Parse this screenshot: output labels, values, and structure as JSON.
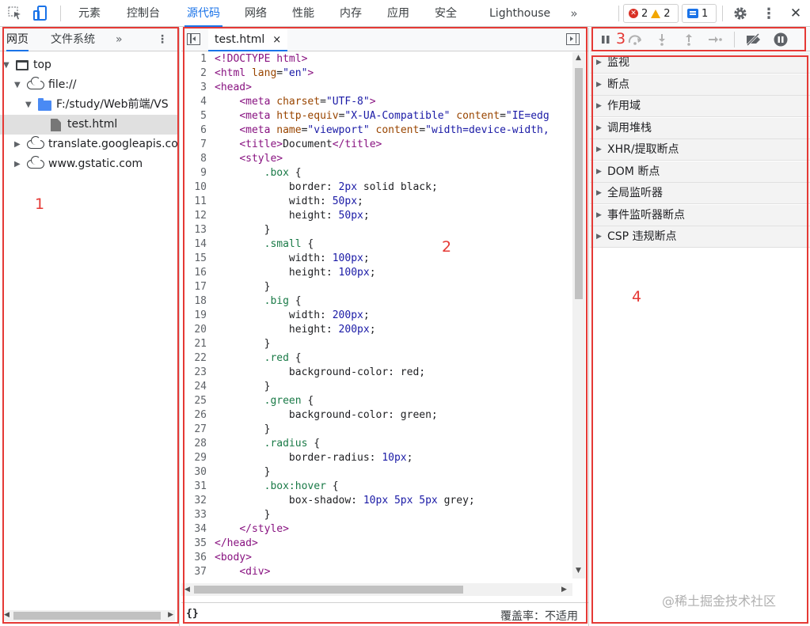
{
  "colors": {
    "accent": "#1a73e8",
    "annotation": "#e53935",
    "error": "#d93025",
    "warning": "#f2a600"
  },
  "toolbar": {
    "inspect_icon": "cursor-select-icon",
    "device_icon": "device-toggle-icon",
    "tabs": [
      "元素",
      "控制台",
      "源代码",
      "网络",
      "性能",
      "内存",
      "应用",
      "安全",
      "Lighthouse"
    ],
    "active_tab": "源代码",
    "more_tabs": "»",
    "errors": "2",
    "warnings": "2",
    "messages": "1",
    "settings_icon": "gear-icon",
    "menu_icon": "kebab-menu-icon",
    "close": "✕"
  },
  "navigator": {
    "tabs": [
      "网页",
      "文件系统"
    ],
    "more": "»",
    "menu": "⋮",
    "tree": [
      {
        "label": "top",
        "level": 0,
        "icon": "frame",
        "expanded": true
      },
      {
        "label": "file://",
        "level": 1,
        "icon": "cloud",
        "expanded": true
      },
      {
        "label": "F:/study/Web前端/VS",
        "level": 2,
        "icon": "folder",
        "expanded": true
      },
      {
        "label": "test.html",
        "level": 3,
        "icon": "file",
        "selected": true
      },
      {
        "label": "translate.googleapis.com",
        "level": 1,
        "icon": "cloud",
        "expanded": false
      },
      {
        "label": "www.gstatic.com",
        "level": 1,
        "icon": "cloud",
        "expanded": false
      }
    ]
  },
  "editor": {
    "file_tab": "test.html",
    "close_tab": "×",
    "pretty_print": "{}",
    "coverage": "覆盖率：不适用",
    "code": [
      [
        [
          "tag",
          "<!DOCTYPE html>"
        ]
      ],
      [
        [
          "tag",
          "<html "
        ],
        [
          "attr",
          "lang"
        ],
        [
          "text",
          "="
        ],
        [
          "str",
          "\"en\""
        ],
        [
          "tag",
          ">"
        ]
      ],
      [
        [
          "tag",
          "<head>"
        ]
      ],
      [
        [
          "text",
          "    "
        ],
        [
          "tag",
          "<meta "
        ],
        [
          "attr",
          "charset"
        ],
        [
          "text",
          "="
        ],
        [
          "str",
          "\"UTF-8\""
        ],
        [
          "tag",
          ">"
        ]
      ],
      [
        [
          "text",
          "    "
        ],
        [
          "tag",
          "<meta "
        ],
        [
          "attr",
          "http-equiv"
        ],
        [
          "text",
          "="
        ],
        [
          "str",
          "\"X-UA-Compatible\""
        ],
        [
          "text",
          " "
        ],
        [
          "attr",
          "content"
        ],
        [
          "text",
          "="
        ],
        [
          "str",
          "\"IE=edg"
        ]
      ],
      [
        [
          "text",
          "    "
        ],
        [
          "tag",
          "<meta "
        ],
        [
          "attr",
          "name"
        ],
        [
          "text",
          "="
        ],
        [
          "str",
          "\"viewport\""
        ],
        [
          "text",
          " "
        ],
        [
          "attr",
          "content"
        ],
        [
          "text",
          "="
        ],
        [
          "str",
          "\"width=device-width,"
        ]
      ],
      [
        [
          "text",
          "    "
        ],
        [
          "tag",
          "<title>"
        ],
        [
          "text",
          "Document"
        ],
        [
          "tag",
          "</title>"
        ]
      ],
      [
        [
          "text",
          "    "
        ],
        [
          "tag",
          "<style>"
        ]
      ],
      [
        [
          "text",
          "        "
        ],
        [
          "sel",
          ".box"
        ],
        [
          "text",
          " {"
        ]
      ],
      [
        [
          "text",
          "            border: "
        ],
        [
          "num",
          "2px"
        ],
        [
          "text",
          " solid black;"
        ]
      ],
      [
        [
          "text",
          "            width: "
        ],
        [
          "num",
          "50px"
        ],
        [
          "text",
          ";"
        ]
      ],
      [
        [
          "text",
          "            height: "
        ],
        [
          "num",
          "50px"
        ],
        [
          "text",
          ";"
        ]
      ],
      [
        [
          "text",
          "        }"
        ]
      ],
      [
        [
          "text",
          "        "
        ],
        [
          "sel",
          ".small"
        ],
        [
          "text",
          " {"
        ]
      ],
      [
        [
          "text",
          "            width: "
        ],
        [
          "num",
          "100px"
        ],
        [
          "text",
          ";"
        ]
      ],
      [
        [
          "text",
          "            height: "
        ],
        [
          "num",
          "100px"
        ],
        [
          "text",
          ";"
        ]
      ],
      [
        [
          "text",
          "        }"
        ]
      ],
      [
        [
          "text",
          "        "
        ],
        [
          "sel",
          ".big"
        ],
        [
          "text",
          " {"
        ]
      ],
      [
        [
          "text",
          "            width: "
        ],
        [
          "num",
          "200px"
        ],
        [
          "text",
          ";"
        ]
      ],
      [
        [
          "text",
          "            height: "
        ],
        [
          "num",
          "200px"
        ],
        [
          "text",
          ";"
        ]
      ],
      [
        [
          "text",
          "        }"
        ]
      ],
      [
        [
          "text",
          "        "
        ],
        [
          "sel",
          ".red"
        ],
        [
          "text",
          " {"
        ]
      ],
      [
        [
          "text",
          "            background-color: red;"
        ]
      ],
      [
        [
          "text",
          "        }"
        ]
      ],
      [
        [
          "text",
          "        "
        ],
        [
          "sel",
          ".green"
        ],
        [
          "text",
          " {"
        ]
      ],
      [
        [
          "text",
          "            background-color: green;"
        ]
      ],
      [
        [
          "text",
          "        }"
        ]
      ],
      [
        [
          "text",
          "        "
        ],
        [
          "sel",
          ".radius"
        ],
        [
          "text",
          " {"
        ]
      ],
      [
        [
          "text",
          "            border-radius: "
        ],
        [
          "num",
          "10px"
        ],
        [
          "text",
          ";"
        ]
      ],
      [
        [
          "text",
          "        }"
        ]
      ],
      [
        [
          "text",
          "        "
        ],
        [
          "sel",
          ".box:hover"
        ],
        [
          "text",
          " {"
        ]
      ],
      [
        [
          "text",
          "            box-shadow: "
        ],
        [
          "num",
          "10px 5px 5px"
        ],
        [
          "text",
          " grey;"
        ]
      ],
      [
        [
          "text",
          "        }"
        ]
      ],
      [
        [
          "text",
          "    "
        ],
        [
          "tag",
          "</style>"
        ]
      ],
      [
        [
          "tag",
          "</head>"
        ]
      ],
      [
        [
          "tag",
          "<body>"
        ]
      ],
      [
        [
          "text",
          "    "
        ],
        [
          "tag",
          "<div>"
        ]
      ]
    ]
  },
  "debugger": {
    "controls": [
      "pause-icon",
      "step-over-icon",
      "step-into-icon",
      "step-out-icon",
      "step-icon",
      "deactivate-breakpoints-icon",
      "pause-on-exceptions-icon"
    ],
    "sections": [
      "监视",
      "断点",
      "作用域",
      "调用堆栈",
      "XHR/提取断点",
      "DOM 断点",
      "全局监听器",
      "事件监听器断点",
      "CSP 违规断点"
    ]
  },
  "annotations": [
    "1",
    "2",
    "3",
    "4"
  ],
  "watermark": "@稀土掘金技术社区"
}
